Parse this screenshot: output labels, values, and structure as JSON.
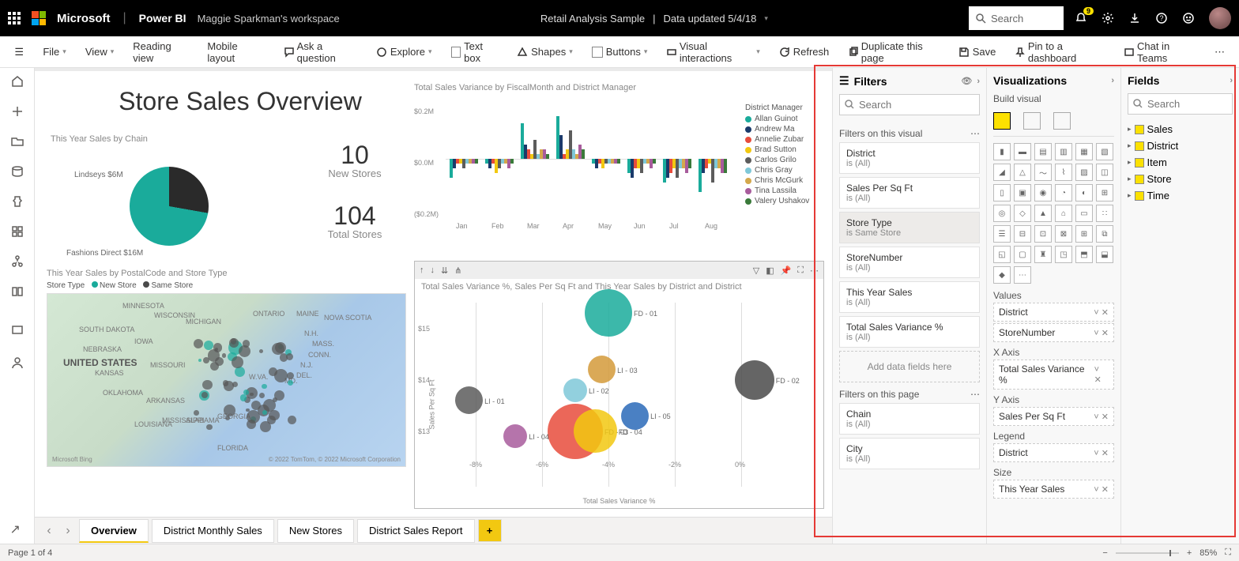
{
  "topbar": {
    "brand": "Microsoft",
    "app": "Power BI",
    "workspace": "Maggie Sparkman's workspace",
    "report": "Retail Analysis Sample",
    "updated": "Data updated 5/4/18",
    "search_placeholder": "Search",
    "notif_badge": "9"
  },
  "ribbon": {
    "file": "File",
    "view": "View",
    "reading": "Reading view",
    "mobile": "Mobile layout",
    "ask": "Ask a question",
    "explore": "Explore",
    "textbox": "Text box",
    "shapes": "Shapes",
    "buttons": "Buttons",
    "visual": "Visual interactions",
    "refresh": "Refresh",
    "duplicate": "Duplicate this page",
    "save": "Save",
    "pin": "Pin to a dashboard",
    "chat": "Chat in Teams"
  },
  "canvas": {
    "title": "Store Sales Overview",
    "pie_title": "This Year Sales by Chain",
    "pie_lbl1": "Lindseys $6M",
    "pie_lbl2": "Fashions Direct $16M",
    "kpi1_val": "10",
    "kpi1_lbl": "New Stores",
    "kpi2_val": "104",
    "kpi2_lbl": "Total Stores",
    "bar_title": "Total Sales Variance by FiscalMonth and District Manager",
    "bar_legend_title": "District Manager",
    "bar_legend": [
      "Allan Guinot",
      "Andrew Ma",
      "Annelie Zubar",
      "Brad Sutton",
      "Carlos Grilo",
      "Chris Gray",
      "Chris McGurk",
      "Tina Lassila",
      "Valery Ushakov"
    ],
    "bar_y": [
      "$0.2M",
      "$0.0M",
      "($0.2M)"
    ],
    "bar_x": [
      "Jan",
      "Feb",
      "Mar",
      "Apr",
      "May",
      "Jun",
      "Jul",
      "Aug"
    ],
    "map_title": "This Year Sales by PostalCode and Store Type",
    "map_leg_lbl": "Store Type",
    "map_leg1": "New Store",
    "map_leg2": "Same Store",
    "map_country": "UNITED STATES",
    "map_credit": "© 2022 TomTom, © 2022 Microsoft Corporation",
    "map_bing": "Microsoft Bing",
    "scatter_title": "Total Sales Variance %, Sales Per Sq Ft and This Year Sales by District and District",
    "scatter_xlabel": "Total Sales Variance %",
    "scatter_ylabel": "Sales Per Sq Ft",
    "scatter_yticks": [
      "$15",
      "$14",
      "$13"
    ],
    "scatter_xticks": [
      "-8%",
      "-6%",
      "-4%",
      "-2%",
      "0%"
    ]
  },
  "tabs": [
    "Overview",
    "District Monthly Sales",
    "New Stores",
    "District Sales Report"
  ],
  "filters": {
    "title": "Filters",
    "search_placeholder": "Search",
    "sect1": "Filters on this visual",
    "cards1": [
      {
        "n": "District",
        "v": "is (All)"
      },
      {
        "n": "Sales Per Sq Ft",
        "v": "is (All)"
      },
      {
        "n": "Store Type",
        "v": "is Same Store",
        "sel": true
      },
      {
        "n": "StoreNumber",
        "v": "is (All)"
      },
      {
        "n": "This Year Sales",
        "v": "is (All)"
      },
      {
        "n": "Total Sales Variance %",
        "v": "is (All)"
      }
    ],
    "add": "Add data fields here",
    "sect2": "Filters on this page",
    "cards2": [
      {
        "n": "Chain",
        "v": "is (All)"
      },
      {
        "n": "City",
        "v": "is (All)"
      }
    ]
  },
  "viz": {
    "title": "Visualizations",
    "build": "Build visual",
    "wells": {
      "values": "Values",
      "values_items": [
        "District",
        "StoreNumber"
      ],
      "xaxis": "X Axis",
      "xaxis_item": "Total Sales Variance %",
      "yaxis": "Y Axis",
      "yaxis_item": "Sales Per Sq Ft",
      "legend": "Legend",
      "legend_item": "District",
      "size": "Size",
      "size_item": "This Year Sales"
    }
  },
  "fields": {
    "title": "Fields",
    "search_placeholder": "Search",
    "tables": [
      "Sales",
      "District",
      "Item",
      "Store",
      "Time"
    ]
  },
  "status": {
    "page": "Page 1 of 4",
    "zoom": "85%"
  },
  "chart_data": {
    "pie": {
      "type": "pie",
      "series": [
        {
          "name": "Lindseys",
          "value": 6
        },
        {
          "name": "Fashions Direct",
          "value": 16
        }
      ],
      "unit": "$M",
      "title": "This Year Sales by Chain"
    },
    "bar": {
      "type": "bar",
      "stacked": false,
      "title": "Total Sales Variance by FiscalMonth and District Manager",
      "categories": [
        "Jan",
        "Feb",
        "Mar",
        "Apr",
        "May",
        "Jun",
        "Jul",
        "Aug"
      ],
      "ylim": [
        -0.2,
        0.2
      ],
      "yunit": "$M",
      "series": [
        {
          "name": "Allan Guinot",
          "color": "#1aab9b",
          "values": [
            -0.08,
            -0.02,
            0.15,
            0.18,
            -0.02,
            -0.06,
            -0.1,
            -0.14
          ]
        },
        {
          "name": "Andrew Ma",
          "color": "#1a3a6b",
          "values": [
            -0.04,
            -0.04,
            0.06,
            0.1,
            -0.04,
            -0.08,
            -0.08,
            -0.06
          ]
        },
        {
          "name": "Annelie Zubar",
          "color": "#e74c3c",
          "values": [
            -0.02,
            -0.02,
            0.04,
            0.02,
            -0.02,
            -0.04,
            -0.06,
            -0.04
          ]
        },
        {
          "name": "Brad Sutton",
          "color": "#f2c811",
          "values": [
            -0.02,
            -0.06,
            0.02,
            0.04,
            -0.04,
            -0.04,
            -0.04,
            -0.02
          ]
        },
        {
          "name": "Carlos Grilo",
          "color": "#5c5c5c",
          "values": [
            -0.04,
            -0.04,
            0.08,
            0.12,
            -0.02,
            -0.06,
            -0.08,
            -0.1
          ]
        },
        {
          "name": "Chris Gray",
          "color": "#7fc8d8",
          "values": [
            -0.02,
            -0.02,
            0.02,
            0.04,
            -0.02,
            -0.02,
            -0.04,
            -0.04
          ]
        },
        {
          "name": "Chris McGurk",
          "color": "#d4a84c",
          "values": [
            -0.02,
            -0.02,
            0.04,
            0.02,
            -0.02,
            -0.02,
            -0.04,
            -0.04
          ]
        },
        {
          "name": "Tina Lassila",
          "color": "#a85c9c",
          "values": [
            -0.02,
            -0.04,
            0.04,
            0.06,
            -0.02,
            -0.04,
            -0.06,
            -0.06
          ]
        },
        {
          "name": "Valery Ushakov",
          "color": "#3a7a3a",
          "values": [
            -0.02,
            -0.02,
            0.02,
            0.04,
            -0.02,
            -0.02,
            -0.04,
            -0.06
          ]
        }
      ]
    },
    "scatter": {
      "type": "scatter",
      "title": "Total Sales Variance %, Sales Per Sq Ft and This Year Sales by District and District",
      "xlabel": "Total Sales Variance %",
      "ylabel": "Sales Per Sq Ft",
      "xlim": [
        -9,
        1
      ],
      "ylim": [
        12.5,
        15.5
      ],
      "points": [
        {
          "label": "FD - 01",
          "x": -4.0,
          "y": 15.3,
          "size": 60,
          "color": "#1aab9b"
        },
        {
          "label": "FD - 02",
          "x": 0.4,
          "y": 14.0,
          "size": 50,
          "color": "#4a4a4a"
        },
        {
          "label": "FD - 03",
          "x": -5.0,
          "y": 13.0,
          "size": 70,
          "color": "#e74c3c"
        },
        {
          "label": "FD - 04",
          "x": -4.4,
          "y": 13.0,
          "size": 55,
          "color": "#f2c811"
        },
        {
          "label": "LI - 01",
          "x": -8.2,
          "y": 13.6,
          "size": 35,
          "color": "#5c5c5c"
        },
        {
          "label": "LI - 02",
          "x": -5.0,
          "y": 13.8,
          "size": 30,
          "color": "#7fc8d8"
        },
        {
          "label": "LI - 03",
          "x": -4.2,
          "y": 14.2,
          "size": 35,
          "color": "#d49a3a"
        },
        {
          "label": "LI - 04",
          "x": -6.8,
          "y": 12.9,
          "size": 30,
          "color": "#a85c9c"
        },
        {
          "label": "LI - 05",
          "x": -3.2,
          "y": 13.3,
          "size": 35,
          "color": "#2a6ab8"
        }
      ]
    }
  },
  "legend_colors": [
    "#1aab9b",
    "#1a3a6b",
    "#e74c3c",
    "#f2c811",
    "#5c5c5c",
    "#7fc8d8",
    "#d4a84c",
    "#a85c9c",
    "#3a7a3a"
  ]
}
